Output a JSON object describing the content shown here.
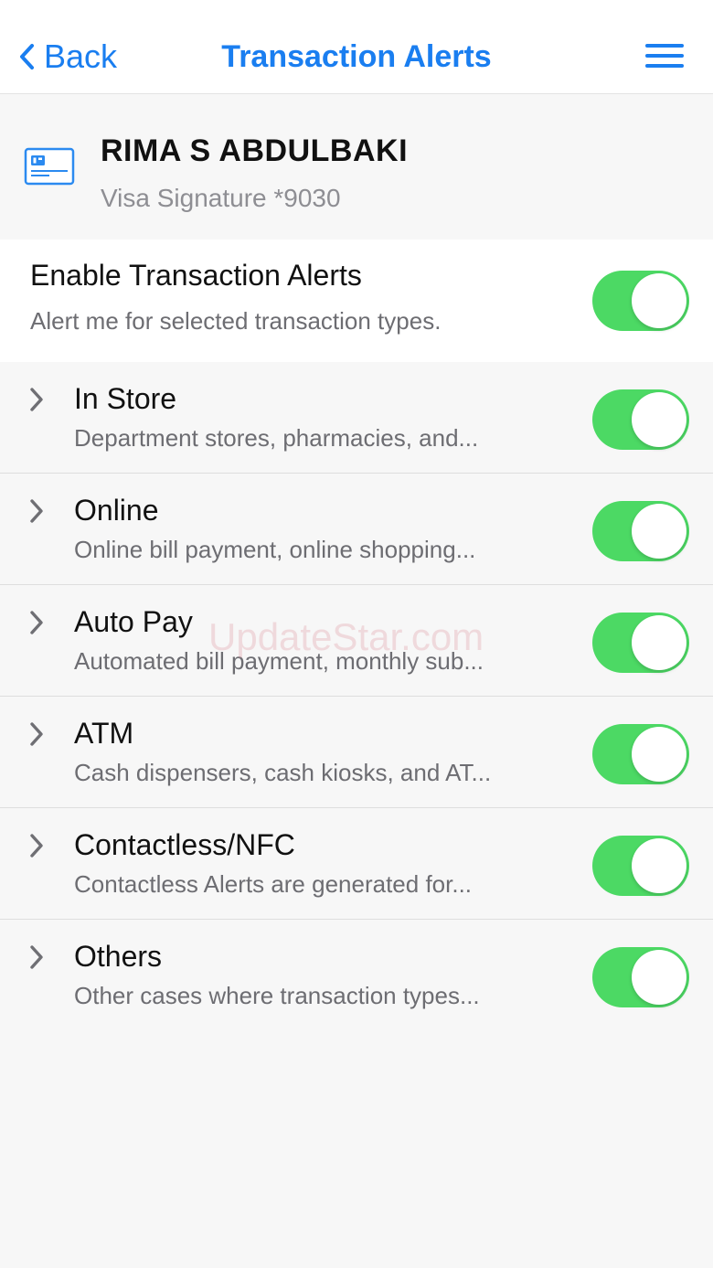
{
  "nav": {
    "back_label": "Back",
    "title": "Transaction Alerts",
    "menu_icon": "hamburger-menu-icon",
    "accent": "#1a7ef0"
  },
  "account": {
    "icon": "credit-card-icon",
    "name": "RIMA S ABDULBAKI",
    "card": "Visa Signature *9030"
  },
  "enable": {
    "title": "Enable Transaction Alerts",
    "subtitle": "Alert me for selected transaction types.",
    "on": true
  },
  "alert_types": [
    {
      "title": "In Store",
      "subtitle": "Department stores, pharmacies, and...",
      "on": true
    },
    {
      "title": "Online",
      "subtitle": "Online bill payment, online shopping...",
      "on": true
    },
    {
      "title": "Auto Pay",
      "subtitle": "Automated bill payment, monthly sub...",
      "on": true
    },
    {
      "title": "ATM",
      "subtitle": "Cash dispensers, cash kiosks, and AT...",
      "on": true
    },
    {
      "title": "Contactless/NFC",
      "subtitle": "Contactless Alerts are generated for...",
      "on": true
    },
    {
      "title": "Others",
      "subtitle": "Other cases where transaction types...",
      "on": true
    }
  ],
  "watermark": "UpdateStar.com",
  "colors": {
    "toggle_on": "#4cd964",
    "background": "#f7f7f7"
  }
}
